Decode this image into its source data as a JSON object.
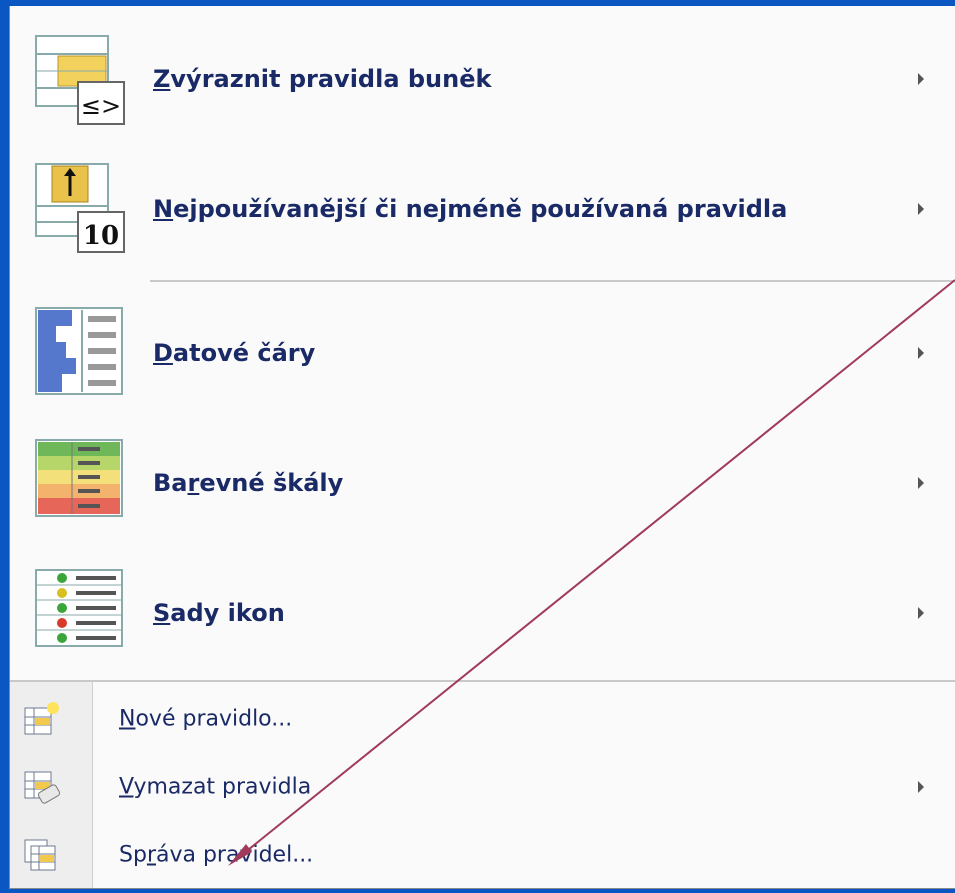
{
  "menu": {
    "items": [
      {
        "label": "Zvýraznit pravidla buněk",
        "hotkey_index": 0,
        "icon": "highlight-cell-rules-icon",
        "submenu": true
      },
      {
        "label": "Nejpoužívanější či nejméně používaná pravidla",
        "hotkey_index": 0,
        "icon": "top-bottom-rules-icon",
        "submenu": true
      },
      {
        "label": "Datové čáry",
        "hotkey_index": 0,
        "icon": "data-bars-icon",
        "submenu": true
      },
      {
        "label": "Barevné škály",
        "hotkey_index": 2,
        "icon": "color-scales-icon",
        "submenu": true
      },
      {
        "label": "Sady ikon",
        "hotkey_index": 0,
        "icon": "icon-sets-icon",
        "submenu": true
      },
      {
        "label": "Nové pravidlo...",
        "hotkey_index": 0,
        "icon": "new-rule-icon",
        "submenu": false
      },
      {
        "label": "Vymazat pravidla",
        "hotkey_index": 0,
        "icon": "clear-rules-icon",
        "submenu": true
      },
      {
        "label": "Správa pravidel...",
        "hotkey_index": 2,
        "icon": "manage-rules-icon",
        "submenu": false
      }
    ],
    "icon_text": {
      "compare": "≤>",
      "top10": "10"
    }
  },
  "colors": {
    "label": "#1a2a66",
    "annotation_arrow": "#a03a5a",
    "background": "#0a57c4"
  }
}
